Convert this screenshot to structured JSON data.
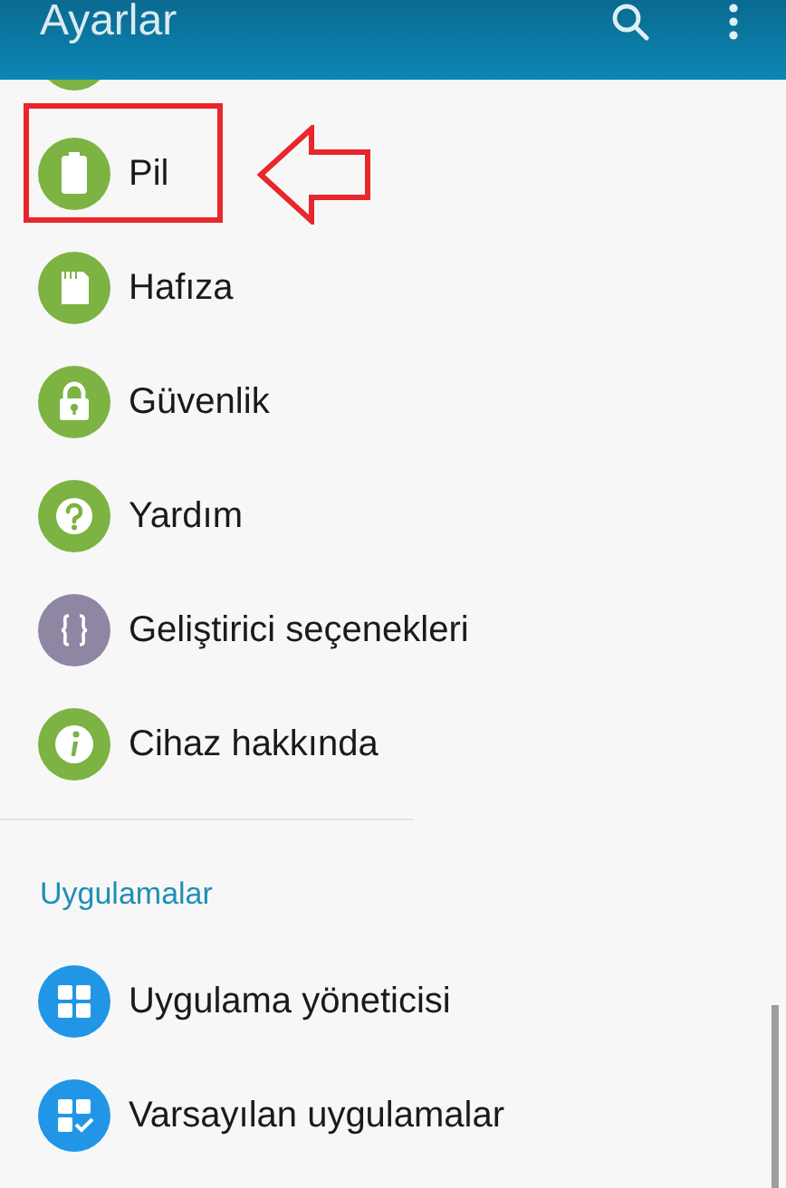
{
  "header": {
    "title": "Ayarlar"
  },
  "device_items": [
    {
      "kind": "partial",
      "color": "#7cb342"
    },
    {
      "kind": "battery",
      "label": "Pil",
      "color": "#7cb342"
    },
    {
      "kind": "storage",
      "label": "Hafıza",
      "color": "#7cb342"
    },
    {
      "kind": "lock",
      "label": "Güvenlik",
      "color": "#7cb342"
    },
    {
      "kind": "help",
      "label": "Yardım",
      "color": "#7cb342"
    },
    {
      "kind": "braces",
      "label": "Geliştirici seçenekleri",
      "color": "#8e86a3"
    },
    {
      "kind": "info",
      "label": "Cihaz hakkında",
      "color": "#7cb342"
    }
  ],
  "section": {
    "title": "Uygulamalar"
  },
  "app_items": [
    {
      "kind": "apps",
      "label": "Uygulama yöneticisi",
      "color": "#2196e6"
    },
    {
      "kind": "apps_check",
      "label": "Varsayılan uygulamalar",
      "color": "#2196e6"
    }
  ]
}
